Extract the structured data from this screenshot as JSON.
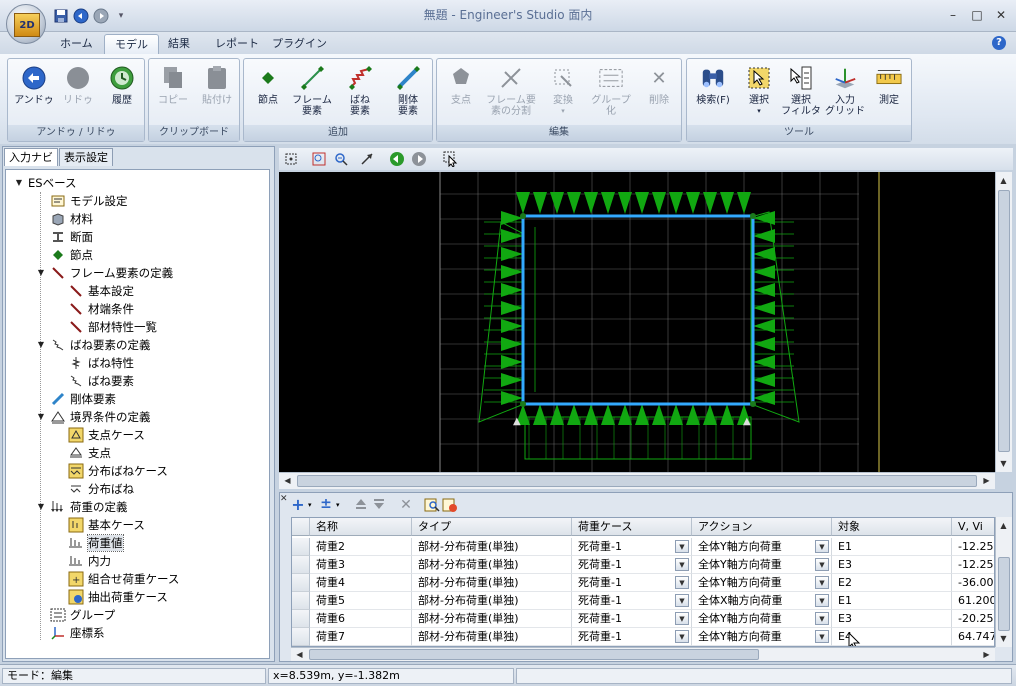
{
  "window": {
    "title": "無題 - Engineer's Studio 面内",
    "logo_text": "2D"
  },
  "tabs": [
    {
      "label": "ホーム",
      "active": false
    },
    {
      "label": "モデル",
      "active": true
    },
    {
      "label": "結果",
      "active": false
    },
    {
      "label": "レポート",
      "active": false
    },
    {
      "label": "プラグイン",
      "active": false
    }
  ],
  "ribbon": {
    "groups": [
      {
        "label": "アンドゥ / リドゥ",
        "buttons": [
          {
            "label": "アンドゥ",
            "icon": "undo-icon",
            "enabled": true
          },
          {
            "label": "リドゥ",
            "icon": "redo-icon",
            "enabled": false
          },
          {
            "label": "履歴",
            "icon": "history-icon",
            "enabled": true
          }
        ]
      },
      {
        "label": "クリップボード",
        "buttons": [
          {
            "label": "コピー",
            "icon": "copy-icon",
            "enabled": false
          },
          {
            "label": "貼付け",
            "icon": "paste-icon",
            "enabled": false
          }
        ]
      },
      {
        "label": "追加",
        "buttons": [
          {
            "label": "節点",
            "icon": "node-icon",
            "enabled": true
          },
          {
            "label1": "フレーム",
            "label2": "要素",
            "icon": "frame-element-icon",
            "enabled": true
          },
          {
            "label1": "ばね",
            "label2": "要素",
            "icon": "spring-element-icon",
            "enabled": true
          },
          {
            "label1": "剛体",
            "label2": "要素",
            "icon": "rigid-element-icon",
            "enabled": true
          }
        ]
      },
      {
        "label": "編集",
        "buttons": [
          {
            "label": "支点",
            "icon": "support-icon",
            "enabled": false
          },
          {
            "label1": "フレーム要",
            "label2": "素の分割",
            "icon": "split-frame-icon",
            "enabled": false
          },
          {
            "label": "変換",
            "icon": "transform-icon",
            "enabled": false
          },
          {
            "label1": "グループ",
            "label2": "化",
            "icon": "group-icon",
            "enabled": false
          },
          {
            "label": "削除",
            "icon": "delete-icon",
            "enabled": false
          }
        ]
      },
      {
        "label": "ツール",
        "buttons": [
          {
            "label": "検索(F)",
            "icon": "search-binoculars-icon",
            "enabled": true
          },
          {
            "label": "選択",
            "icon": "select-icon",
            "enabled": true
          },
          {
            "label1": "選択",
            "label2": "フィルタ",
            "icon": "select-filter-icon",
            "enabled": true
          },
          {
            "label1": "入力",
            "label2": "グリッド",
            "icon": "input-grid-icon",
            "enabled": true
          },
          {
            "label": "測定",
            "icon": "measure-icon",
            "enabled": true
          }
        ]
      }
    ]
  },
  "nav": {
    "tabs": [
      {
        "label": "入力ナビ",
        "active": true
      },
      {
        "label": "表示設定",
        "active": false
      }
    ],
    "tree": [
      {
        "label": "ESベース",
        "level": 0,
        "expanded": true,
        "icon": "none"
      },
      {
        "label": "モデル設定",
        "level": 1,
        "icon": "model-settings-icon"
      },
      {
        "label": "材料",
        "level": 1,
        "icon": "material-icon"
      },
      {
        "label": "断面",
        "level": 1,
        "icon": "section-icon"
      },
      {
        "label": "節点",
        "level": 1,
        "icon": "node-icon"
      },
      {
        "label": "フレーム要素の定義",
        "level": 1,
        "expanded": true,
        "icon": "frame-icon"
      },
      {
        "label": "基本設定",
        "level": 2,
        "icon": "frame-icon"
      },
      {
        "label": "材端条件",
        "level": 2,
        "icon": "frame-icon"
      },
      {
        "label": "部材特性一覧",
        "level": 2,
        "icon": "frame-icon"
      },
      {
        "label": "ばね要素の定義",
        "level": 1,
        "expanded": true,
        "icon": "spring-icon"
      },
      {
        "label": "ばね特性",
        "level": 2,
        "icon": "spring-property-icon"
      },
      {
        "label": "ばね要素",
        "level": 2,
        "icon": "spring-icon"
      },
      {
        "label": "剛体要素",
        "level": 1,
        "icon": "rigid-icon"
      },
      {
        "label": "境界条件の定義",
        "level": 1,
        "expanded": true,
        "icon": "boundary-icon"
      },
      {
        "label": "支点ケース",
        "level": 2,
        "icon": "support-case-icon"
      },
      {
        "label": "支点",
        "level": 2,
        "icon": "support-icon"
      },
      {
        "label": "分布ばねケース",
        "level": 2,
        "icon": "distributed-spring-case-icon"
      },
      {
        "label": "分布ばね",
        "level": 2,
        "icon": "distributed-spring-icon"
      },
      {
        "label": "荷重の定義",
        "level": 1,
        "expanded": true,
        "icon": "load-icon"
      },
      {
        "label": "基本ケース",
        "level": 2,
        "icon": "basic-case-icon"
      },
      {
        "label": "荷重値",
        "level": 2,
        "icon": "load-value-icon",
        "selected": true
      },
      {
        "label": "内力",
        "level": 2,
        "icon": "internal-force-icon"
      },
      {
        "label": "組合せ荷重ケース",
        "level": 2,
        "icon": "combination-case-icon"
      },
      {
        "label": "抽出荷重ケース",
        "level": 2,
        "icon": "extract-case-icon"
      },
      {
        "label": "グループ",
        "level": 1,
        "icon": "group-icon"
      },
      {
        "label": "座標系",
        "level": 1,
        "icon": "coordinate-icon"
      }
    ]
  },
  "table": {
    "columns": [
      "名称",
      "タイプ",
      "荷重ケース",
      "アクション",
      "対象",
      "V, Vi"
    ],
    "rows": [
      {
        "name": "荷重2",
        "type": "部材-分布荷重(単独)",
        "case": "死荷重-1",
        "action": "全体Y軸方向荷重",
        "target": "E1",
        "value": "-12.250"
      },
      {
        "name": "荷重3",
        "type": "部材-分布荷重(単独)",
        "case": "死荷重-1",
        "action": "全体Y軸方向荷重",
        "target": "E3",
        "value": "-12.250"
      },
      {
        "name": "荷重4",
        "type": "部材-分布荷重(単独)",
        "case": "死荷重-1",
        "action": "全体Y軸方向荷重",
        "target": "E2",
        "value": "-36.000"
      },
      {
        "name": "荷重5",
        "type": "部材-分布荷重(単独)",
        "case": "死荷重-1",
        "action": "全体X軸方向荷重",
        "target": "E1",
        "value": "61.200"
      },
      {
        "name": "荷重6",
        "type": "部材-分布荷重(単独)",
        "case": "死荷重-1",
        "action": "全体Y軸方向荷重",
        "target": "E3",
        "value": "-20.250"
      },
      {
        "name": "荷重7",
        "type": "部材-分布荷重(単独)",
        "case": "死荷重-1",
        "action": "全体Y軸方向荷重",
        "target": "E4",
        "value": "64.747"
      }
    ]
  },
  "status": {
    "mode": "モード：編集",
    "coords": "x=8.539m, y=-1.382m"
  },
  "colors": {
    "accent": "#2e67c9",
    "load": "#11a811",
    "frame": "#33aaff",
    "grid": "#888888"
  }
}
